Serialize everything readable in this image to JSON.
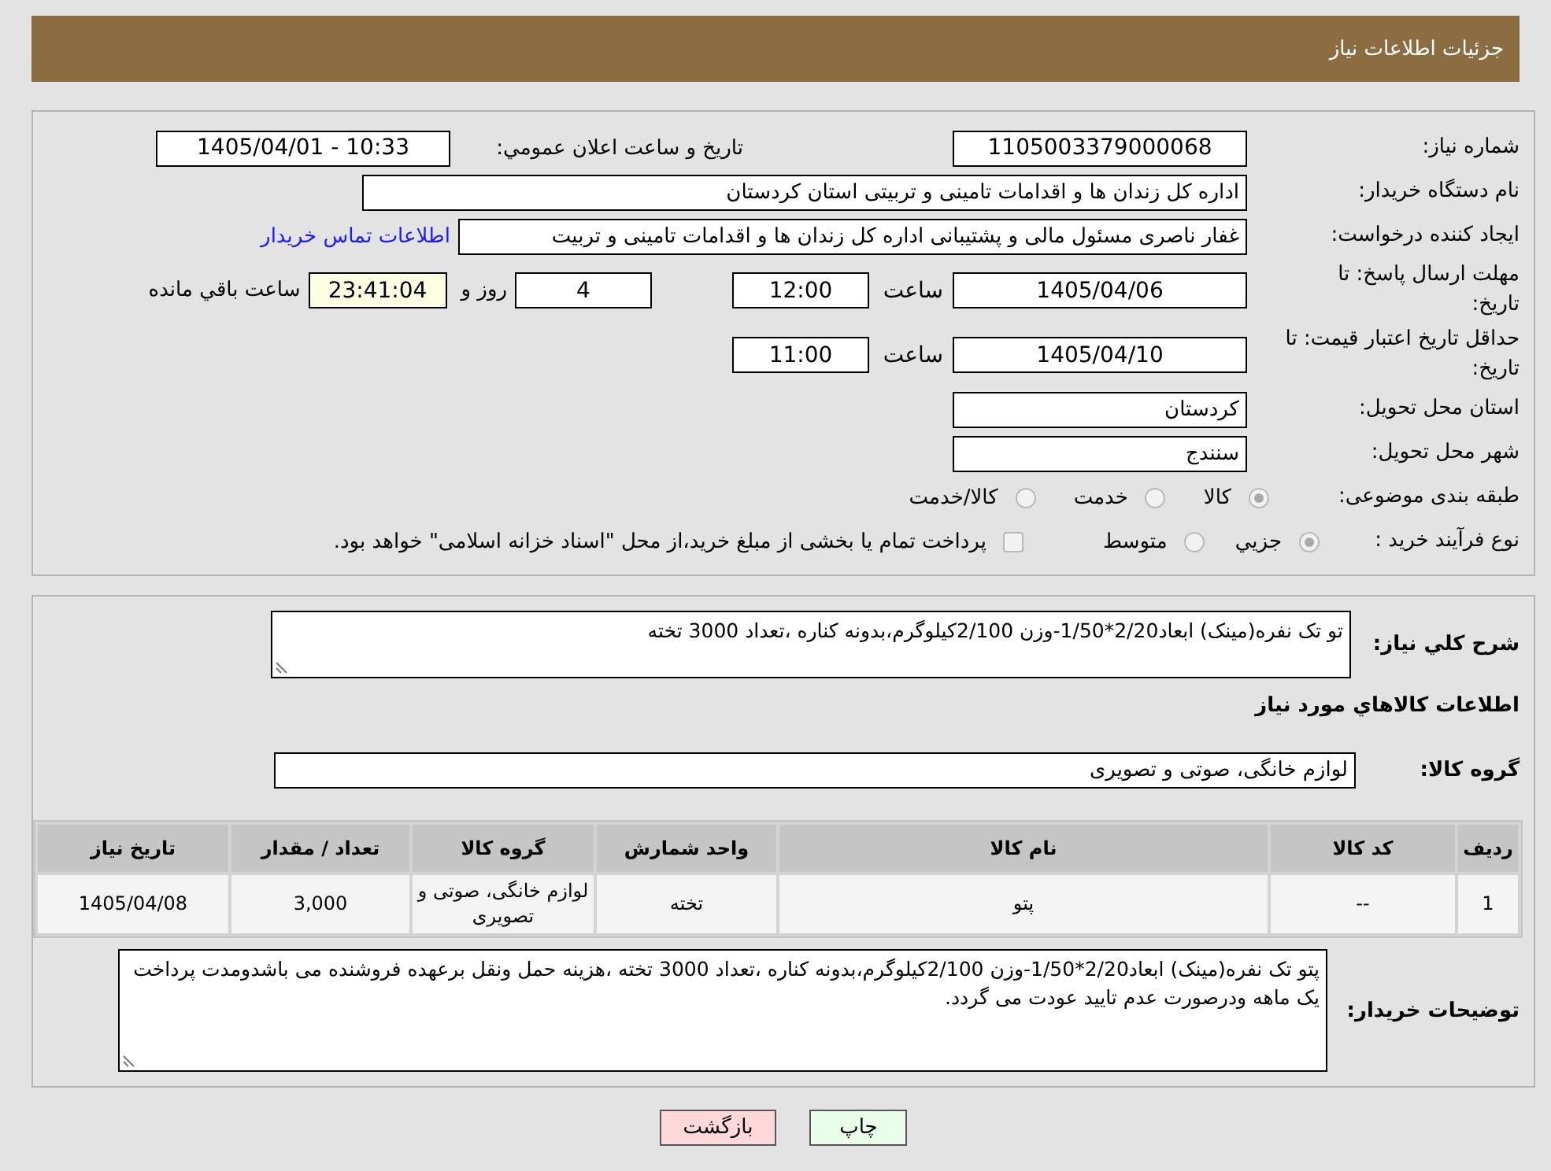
{
  "header": {
    "title": "جزئیات اطلاعات نیاز"
  },
  "details": {
    "need_number": {
      "label": "شماره نیاز:",
      "value": "1105003379000068"
    },
    "announcement": {
      "label": "تاريخ و ساعت اعلان عمومي:",
      "value": "1405/04/01 - 10:33"
    },
    "buyer_org": {
      "label": "نام دستگاه خریدار:",
      "value": "اداره کل زندان ها و اقدامات تامینی و تربیتی استان کردستان"
    },
    "requester": {
      "label": "ایجاد کننده درخواست:",
      "value": "غفار ناصری مسئول مالی و پشتیبانی اداره کل زندان ها و اقدامات تامینی و تربیت",
      "contact_link": "اطلاعات تماس خریدار"
    },
    "response_deadline": {
      "label": "مهلت ارسال پاسخ: تا تاريخ:",
      "date": "1405/04/06",
      "time_label": "ساعت",
      "time": "12:00",
      "days": "4",
      "days_label": "روز و",
      "remaining": "23:41:04",
      "remaining_label": "ساعت باقي مانده"
    },
    "price_validity": {
      "label": "حداقل تاريخ اعتبار قيمت: تا تاريخ:",
      "date": "1405/04/10",
      "time_label": "ساعت",
      "time": "11:00"
    },
    "delivery_province": {
      "label": "استان محل تحویل:",
      "value": "کردستان"
    },
    "delivery_city": {
      "label": "شهر محل تحویل:",
      "value": "سنندج"
    },
    "category": {
      "label": "طبقه بندی موضوعی:",
      "options": [
        {
          "label": "کالا",
          "selected": true,
          "disabled": true
        },
        {
          "label": "خدمت",
          "selected": false,
          "disabled": true
        },
        {
          "label": "کالا/خدمت",
          "selected": false,
          "disabled": true
        }
      ]
    },
    "purchase_process": {
      "label": "نوع فرآیند خرید :",
      "options": [
        {
          "label": "جزيي",
          "selected": true,
          "disabled": true
        },
        {
          "label": "متوسط",
          "selected": false,
          "disabled": true
        }
      ],
      "treasury_payment": {
        "label": "پرداخت تمام یا بخشی از مبلغ خرید،از محل \"اسناد خزانه اسلامی\" خواهد بود.",
        "checked": false,
        "disabled": true
      }
    }
  },
  "goods": {
    "description": {
      "label": "شرح کلي نياز:",
      "value": "تو تک نفره(مینک) ابعاد2/20*1/50-وزن 2/100کیلوگرم،بدونه کناره ،تعداد 3000 تخته"
    },
    "heading": "اطلاعات كالاهاي مورد نياز",
    "group": {
      "label": "گروه کالا:",
      "value": "لوازم خانگی، صوتی و تصویری"
    },
    "table": {
      "columns": [
        "ردیف",
        "کد کالا",
        "نام کالا",
        "واحد شمارش",
        "گروه کالا",
        "تعداد / مقدار",
        "تاريخ نياز"
      ],
      "rows": [
        [
          "1",
          "--",
          "پتو",
          "تخته",
          "لوازم خانگی، صوتی و تصویری",
          "3,000",
          "1405/04/08"
        ]
      ]
    },
    "buyer_notes": {
      "label": "توضیحات خریدار:",
      "value": "پتو تک نفره(مینک) ابعاد2/20*1/50-وزن 2/100کیلوگرم،بدونه کناره ،تعداد 3000 تخته ،هزینه حمل ونقل برعهده فروشنده می باشدومدت پرداخت یک ماهه ودرصورت عدم تایید عودت می گردد."
    }
  },
  "buttons": [
    {
      "label": "چاپ",
      "kind": "print"
    },
    {
      "label": "بازگشت",
      "kind": "back"
    }
  ]
}
